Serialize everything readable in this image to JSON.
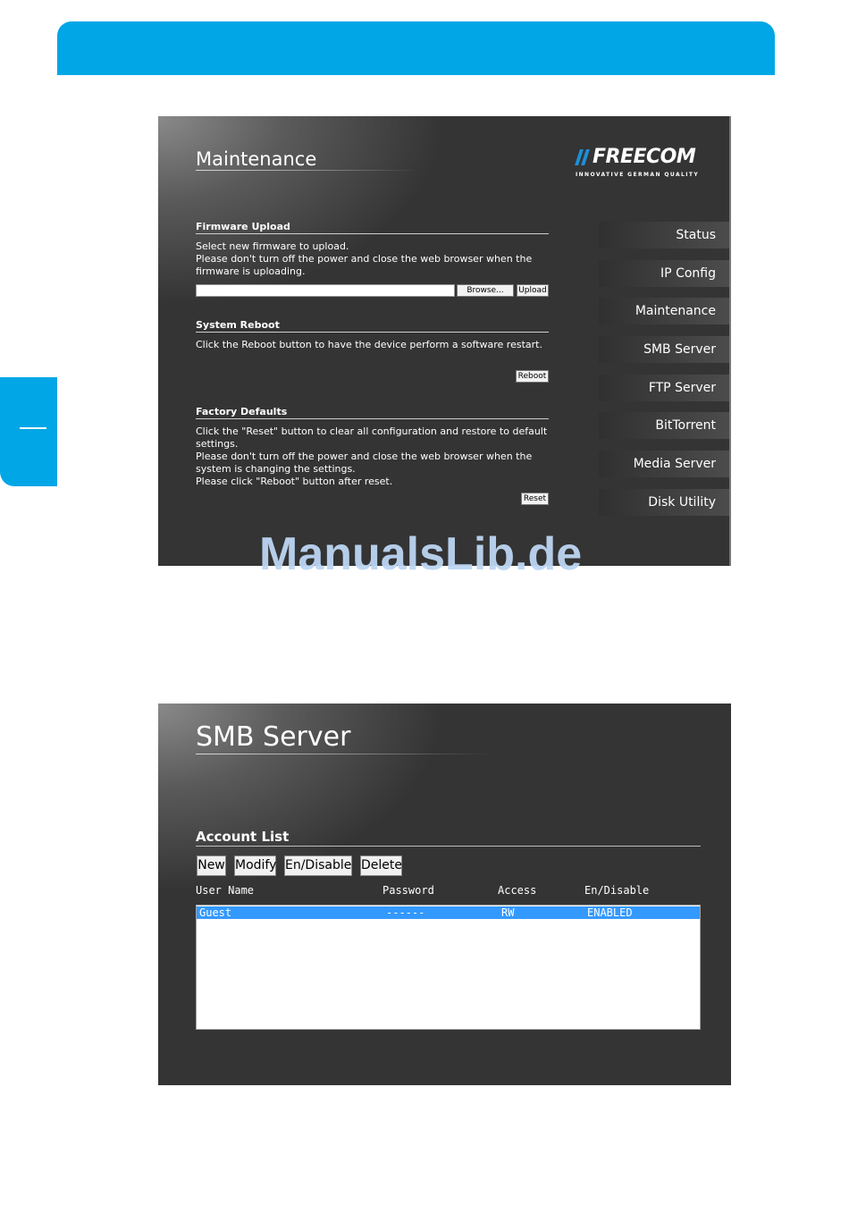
{
  "layout_chrome": {
    "banner_color": "#00a6e6"
  },
  "maintenance": {
    "title": "Maintenance",
    "logo": {
      "brand": "FREECOM",
      "tagline": "INNOVATIVE GERMAN QUALITY"
    },
    "firmware_upload": {
      "title": "Firmware Upload",
      "line1": "Select new firmware to upload.",
      "line2": "Please don't turn off the power and close the web browser when the firmware is uploading.",
      "file_value": "",
      "browse_label": "Browse...",
      "upload_label": "Upload"
    },
    "system_reboot": {
      "title": "System Reboot",
      "text": "Click the Reboot button to have the device perform a software restart.",
      "reboot_label": "Reboot"
    },
    "factory_defaults": {
      "title": "Factory Defaults",
      "line1": "Click the \"Reset\" button to clear all configuration and restore to default settings.",
      "line2": "Please don't turn off the power and close the web browser when the system is changing the settings.",
      "line3": "Please click \"Reboot\" button after reset.",
      "reset_label": "Reset"
    },
    "nav": [
      "Status",
      "IP Config",
      "Maintenance",
      "SMB Server",
      "FTP Server",
      "BitTorrent",
      "Media Server",
      "Disk Utility"
    ],
    "watermark": "ManualsLib.de"
  },
  "smb": {
    "title": "SMB Server",
    "account_list_title": "Account List",
    "buttons": {
      "new": "New",
      "modify": "Modify",
      "endisable": "En/Disable",
      "delete": "Delete"
    },
    "columns": {
      "user_name": "User Name",
      "password": "Password",
      "access": "Access",
      "endisable": "En/Disable"
    },
    "rows": [
      {
        "user_name": "Guest",
        "password": "------",
        "access": "RW",
        "status": "ENABLED"
      }
    ]
  }
}
